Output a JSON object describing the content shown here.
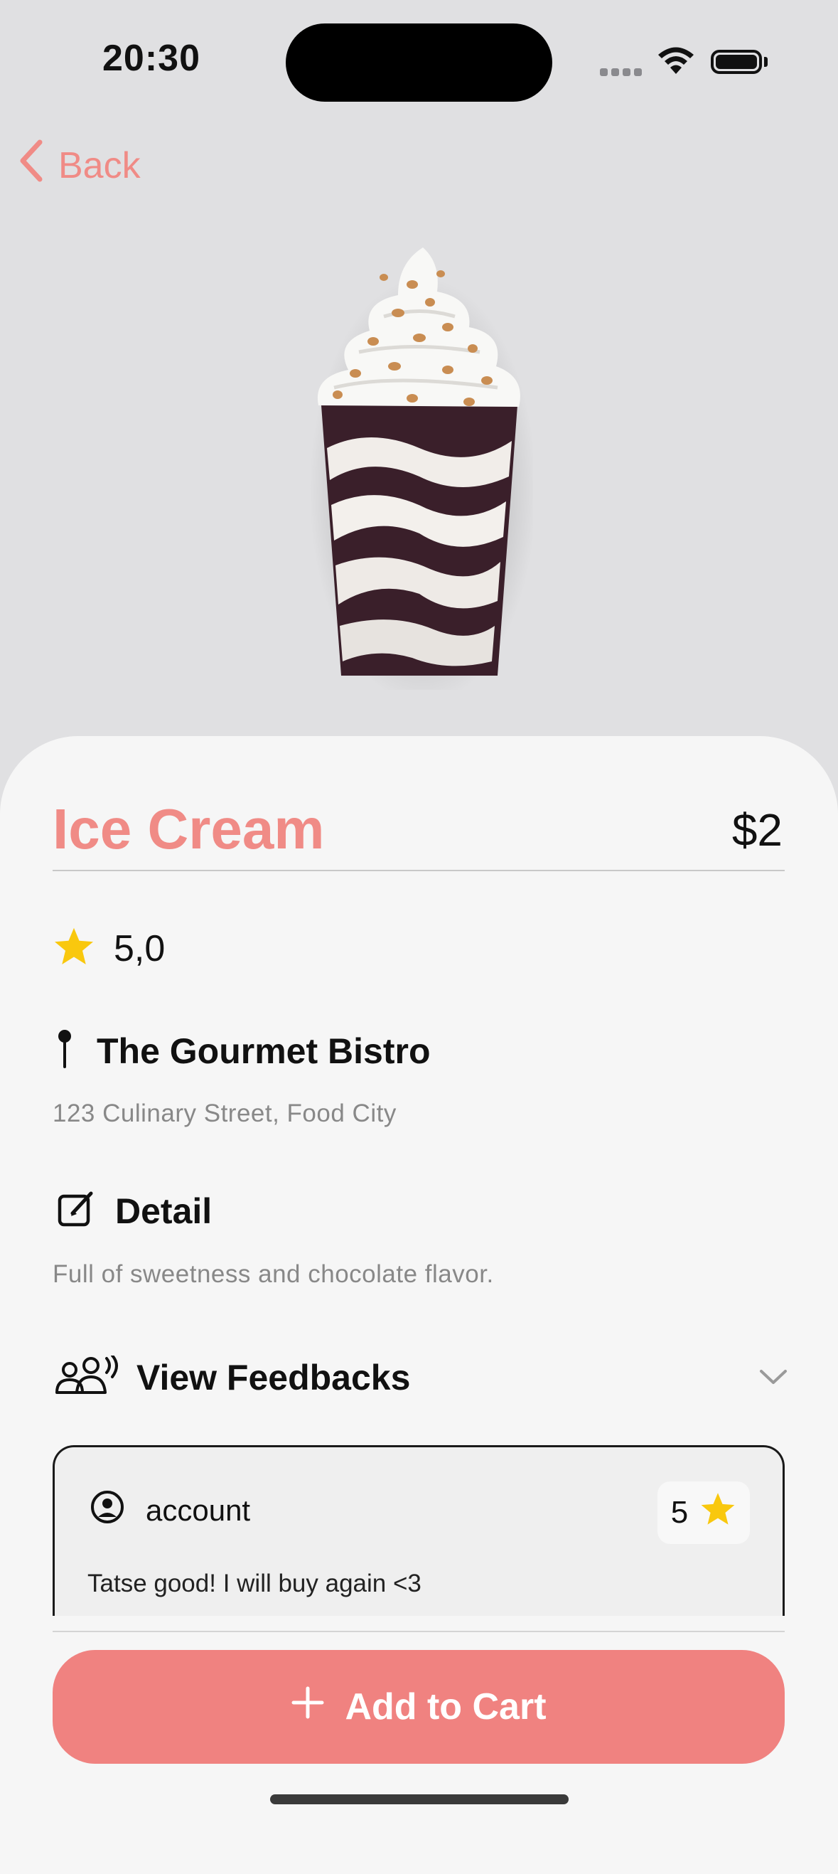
{
  "status_bar": {
    "time": "20:30"
  },
  "nav": {
    "back_label": "Back"
  },
  "product": {
    "name": "Ice Cream",
    "price": "$2",
    "rating": "5,0",
    "restaurant": "The Gourmet Bistro",
    "address": "123 Culinary Street, Food City",
    "detail_title": "Detail",
    "detail_text": "Full of sweetness and chocolate flavor."
  },
  "feedbacks": {
    "title": "View Feedbacks",
    "items": [
      {
        "user": "account",
        "score": "5",
        "comment": "Tatse good! I will buy again <3"
      }
    ]
  },
  "cart": {
    "button_label": "Add to Cart"
  },
  "colors": {
    "accent": "#f08b86",
    "star": "#f9c80e",
    "sheet": "#f6f6f6"
  }
}
